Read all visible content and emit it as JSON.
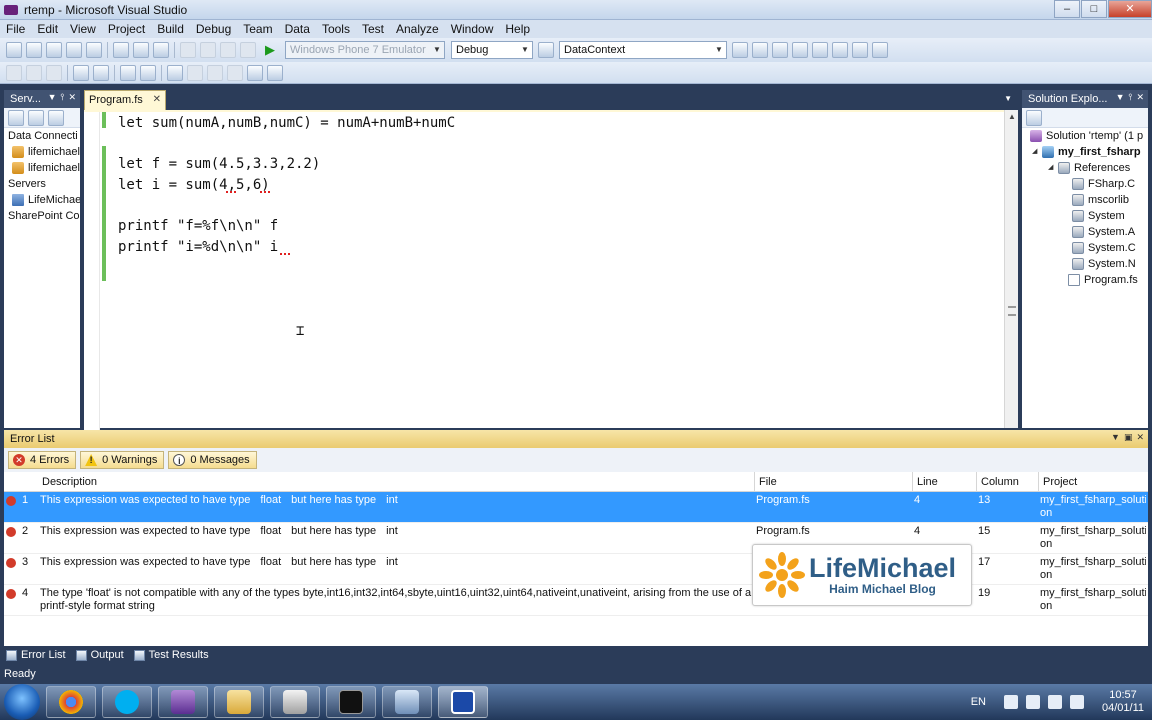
{
  "window": {
    "title": "rtemp - Microsoft Visual Studio"
  },
  "menu": [
    "File",
    "Edit",
    "View",
    "Project",
    "Build",
    "Debug",
    "Team",
    "Data",
    "Tools",
    "Test",
    "Analyze",
    "Window",
    "Help"
  ],
  "toolbar": {
    "target": "Windows Phone 7 Emulator",
    "config": "Debug",
    "find": "DataContext"
  },
  "server_explorer": {
    "title": "Serv...",
    "items": [
      "Data Connecti",
      "lifemichael",
      "lifemichael",
      "Servers",
      "LifeMichae",
      "SharePoint Cor"
    ]
  },
  "editor": {
    "tab": "Program.fs",
    "lines": [
      "let sum(numA,numB,numC) = numA+numB+numC",
      "",
      "let f = sum(4.5,3.3,2.2)",
      "let i = sum(4,5,6)",
      "",
      "printf \"f=%f\\n\\n\" f",
      "printf \"i=%d\\n\\n\" i"
    ]
  },
  "solution_explorer": {
    "title": "Solution Explo...",
    "solution": "Solution 'rtemp' (1 p",
    "project": "my_first_fsharp",
    "references_label": "References",
    "references": [
      "FSharp.C",
      "mscorlib",
      "System",
      "System.A",
      "System.C",
      "System.N"
    ],
    "file": "Program.fs"
  },
  "error_list": {
    "title": "Error List",
    "errors_btn": "4 Errors",
    "warnings_btn": "0 Warnings",
    "messages_btn": "0 Messages",
    "headers": {
      "description": "Description",
      "file": "File",
      "line": "Line",
      "column": "Column",
      "project": "Project"
    },
    "rows": [
      {
        "num": "1",
        "desc_a": "This expression was expected to have type",
        "desc_b": "float",
        "desc_c": "but here has type",
        "desc_d": "int",
        "file": "Program.fs",
        "line": "4",
        "column": "13",
        "project": "my_first_fsharp_soluti on",
        "selected": true
      },
      {
        "num": "2",
        "desc_a": "This expression was expected to have type",
        "desc_b": "float",
        "desc_c": "but here has type",
        "desc_d": "int",
        "file": "Program.fs",
        "line": "4",
        "column": "15",
        "project": "my_first_fsharp_soluti on",
        "selected": false
      },
      {
        "num": "3",
        "desc_a": "This expression was expected to have type",
        "desc_b": "float",
        "desc_c": "but here has type",
        "desc_d": "int",
        "file": "",
        "line": "",
        "column": "17",
        "project": "my_first_fsharp_soluti on",
        "selected": false
      },
      {
        "num": "4",
        "desc_a": "The type 'float' is not compatible with any of the types byte,int16,int32,int64,sbyte,uint16,uint32,uint64,nativeint,unativeint, arising from the use of a printf-style format string",
        "desc_b": "",
        "desc_c": "",
        "desc_d": "",
        "file": "",
        "line": "",
        "column": "19",
        "project": "my_first_fsharp_soluti on",
        "selected": false
      }
    ]
  },
  "watermark": {
    "title": "LifeMichael",
    "subtitle": "Haim Michael Blog"
  },
  "bottom_tabs": [
    "Error List",
    "Output",
    "Test Results"
  ],
  "status": "Ready",
  "tray": {
    "lang": "EN",
    "time": "10:57",
    "date": "04/01/11"
  },
  "colors": {
    "accent": "#3399ff",
    "error": "#d23b2a",
    "panel": "#2b3c59",
    "change_bar": "#6cbf5a"
  }
}
